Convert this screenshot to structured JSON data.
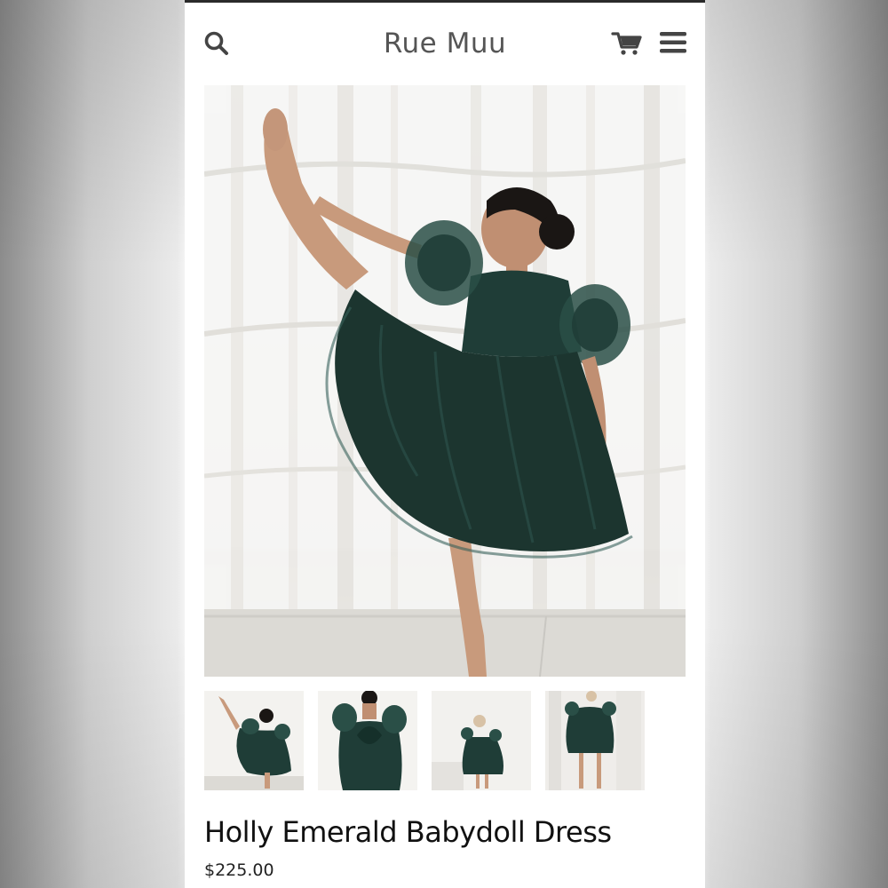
{
  "header": {
    "brand": "Rue Muu",
    "icons": [
      "search-icon",
      "cart-icon",
      "menu-icon"
    ]
  },
  "product": {
    "title": "Holly Emerald Babydoll Dress",
    "price": "$225.00",
    "thumbnail_count": 4
  },
  "colors": {
    "dress": "#1f3d37",
    "text": "#111111",
    "brand_text": "#555555",
    "icon": "#444444"
  }
}
